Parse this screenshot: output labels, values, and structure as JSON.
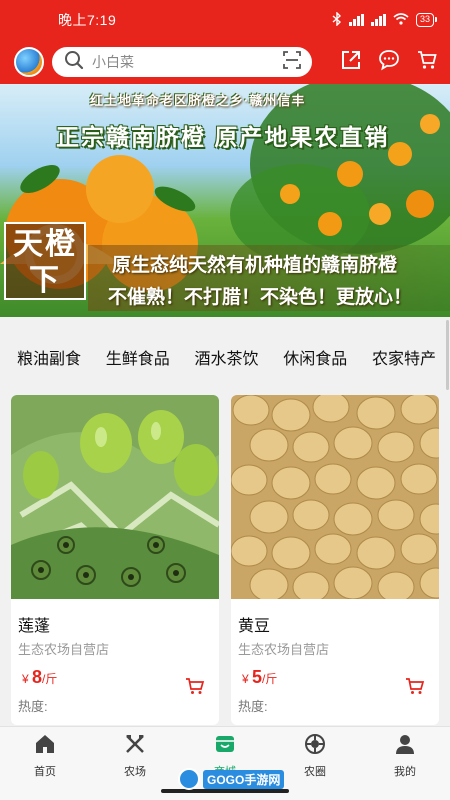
{
  "status": {
    "time": "晚上7:19",
    "battery": "33"
  },
  "search": {
    "placeholder": "小白菜"
  },
  "banner": {
    "line1": "红土地革命老区脐橙之乡·赣州信丰",
    "line2": "正宗赣南脐橙 原产地果农直销",
    "stamp": "天橙下",
    "line3": "原生态纯天然有机种植的赣南脐橙",
    "line4": "不催熟！不打腊！不染色！更放心！"
  },
  "categories": [
    "粮油副食",
    "生鲜食品",
    "酒水茶饮",
    "休闲食品",
    "农家特产"
  ],
  "products": [
    {
      "name": "莲蓬",
      "shop": "生态农场自营店",
      "currency": "¥",
      "price": "8",
      "unit": "/斤",
      "heat": "热度:"
    },
    {
      "name": "黄豆",
      "shop": "生态农场自营店",
      "currency": "¥",
      "price": "5",
      "unit": "/斤",
      "heat": "热度:"
    }
  ],
  "nav": [
    {
      "label": "首页",
      "icon": "home-icon"
    },
    {
      "label": "农场",
      "icon": "farm-tools-icon"
    },
    {
      "label": "商城",
      "icon": "shop-icon"
    },
    {
      "label": "农圈",
      "icon": "circle-icon"
    },
    {
      "label": "我的",
      "icon": "user-icon"
    }
  ],
  "watermark": {
    "text": "GOGO手游网"
  },
  "colors": {
    "brand_red": "#e8251d",
    "nav_active": "#17a86a"
  }
}
